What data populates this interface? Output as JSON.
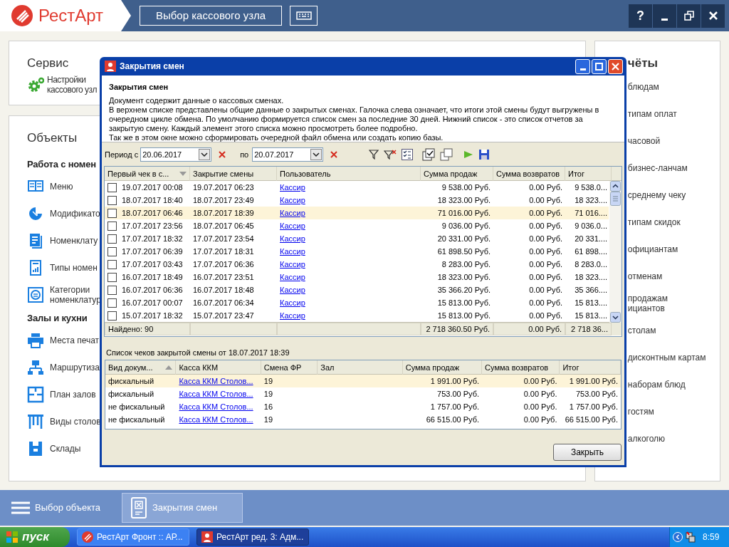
{
  "header": {
    "logo": "РестАрт",
    "node_button": "Выбор кассового узла",
    "buttons": [
      "?"
    ]
  },
  "service": {
    "title": "Сервис",
    "items": [
      {
        "lines": [
          "Настройки",
          "кассового узл"
        ]
      }
    ]
  },
  "objects": {
    "title": "Объекты",
    "groups": [
      {
        "title": "Работа с номен",
        "items": [
          {
            "kind": "menu",
            "lines": [
              "Меню"
            ]
          },
          {
            "kind": "modifiers",
            "lines": [
              "Модификато"
            ]
          },
          {
            "kind": "nomenclature",
            "lines": [
              "Номенклату"
            ]
          },
          {
            "kind": "types",
            "lines": [
              "Типы номен"
            ]
          },
          {
            "kind": "categories",
            "lines": [
              "Категории",
              "номенклатур"
            ]
          }
        ]
      },
      {
        "title": "Залы и кухни",
        "items": [
          {
            "kind": "printer",
            "lines": [
              "Места печат"
            ]
          },
          {
            "kind": "routing",
            "lines": [
              "Маршрутиза"
            ]
          },
          {
            "kind": "plan",
            "lines": [
              "План залов"
            ]
          },
          {
            "kind": "tables",
            "lines": [
              "Виды столов"
            ]
          },
          {
            "kind": "storage",
            "lines": [
              "Склады"
            ]
          }
        ]
      }
    ]
  },
  "reports": {
    "title": "чёты",
    "items": [
      {
        "lines": [
          "блюдам"
        ]
      },
      {
        "lines": [
          "типам оплат"
        ]
      },
      {
        "lines": [
          "часовой"
        ]
      },
      {
        "lines": [
          "бизнес-ланчам"
        ]
      },
      {
        "lines": [
          "среднему чеку"
        ]
      },
      {
        "lines": [
          "типам скидок"
        ]
      },
      {
        "lines": [
          "официантам"
        ]
      },
      {
        "lines": [
          "отменам"
        ]
      },
      {
        "lines": [
          "продажам",
          "ициантов"
        ]
      },
      {
        "lines": [
          "столам"
        ]
      },
      {
        "lines": [
          "дисконтным картам"
        ]
      },
      {
        "lines": [
          "наборам блюд"
        ]
      },
      {
        "lines": [
          "гостям"
        ]
      },
      {
        "lines": [
          "алкоголю"
        ]
      }
    ]
  },
  "dialog": {
    "title": "Закрытия смен",
    "heading": "Закрытия смен",
    "description": [
      "Документ содержит данные о кассовых сменах.",
      "В верхнем списке представлены общие данные о закрытых сменах. Галочка слева означает, что итоги этой смены будут выгружены в очередном цикле обмена. По умолчанию формируется список смен за последние 30 дней. Нижний список - это список отчетов за закрытую смену. Каждый элемент этого списка можно просмотреть более подробно.",
      "Так же в этом окне можно сформировать очередной файл обмена или создать копию базы."
    ],
    "period_label": "Период с",
    "date_from": "20.06.2017",
    "to_label": "по",
    "date_to": "20.07.2017",
    "shifts": {
      "columns": [
        "Первый чек в с...",
        "Закрытие смены",
        "Пользователь",
        "Сумма продаж",
        "Сумма возвратов",
        "Итог"
      ],
      "rows": [
        {
          "checked": false,
          "selected": false,
          "cells": [
            "19.07.2017 00:08",
            "19.07.2017 06:23",
            "Кассир",
            "9 538.00 Руб.",
            "0.00 Руб.",
            "9 538.0..."
          ]
        },
        {
          "checked": false,
          "selected": false,
          "cells": [
            "18.07.2017 18:40",
            "18.07.2017 23:49",
            "Кассир",
            "18 323.00 Руб.",
            "0.00 Руб.",
            "18 323...."
          ]
        },
        {
          "checked": false,
          "selected": true,
          "cells": [
            "18.07.2017 06:46",
            "18.07.2017 18:39",
            "Кассир",
            "71 016.00 Руб.",
            "0.00 Руб.",
            "71 016...."
          ]
        },
        {
          "checked": false,
          "selected": false,
          "cells": [
            "17.07.2017 23:56",
            "18.07.2017 06:45",
            "Кассир",
            "9 036.00 Руб.",
            "0.00 Руб.",
            "9 036.0..."
          ]
        },
        {
          "checked": false,
          "selected": false,
          "cells": [
            "17.07.2017 18:32",
            "17.07.2017 23:54",
            "Кассир",
            "20 331.00 Руб.",
            "0.00 Руб.",
            "20 331...."
          ]
        },
        {
          "checked": false,
          "selected": false,
          "cells": [
            "17.07.2017 06:39",
            "17.07.2017 18:31",
            "Кассир",
            "61 898.50 Руб.",
            "0.00 Руб.",
            "61 898...."
          ]
        },
        {
          "checked": false,
          "selected": false,
          "cells": [
            "17.07.2017 03:43",
            "17.07.2017 06:36",
            "Кассир",
            "8 283.00 Руб.",
            "0.00 Руб.",
            "8 283.0..."
          ]
        },
        {
          "checked": false,
          "selected": false,
          "cells": [
            "16.07.2017 18:49",
            "16.07.2017 23:51",
            "Кассир",
            "18 323.00 Руб.",
            "0.00 Руб.",
            "18 323...."
          ]
        },
        {
          "checked": false,
          "selected": false,
          "cells": [
            "16.07.2017 06:36",
            "16.07.2017 18:48",
            "Кассир",
            "35 366.20 Руб.",
            "0.00 Руб.",
            "35 366...."
          ]
        },
        {
          "checked": false,
          "selected": false,
          "cells": [
            "16.07.2017 00:07",
            "16.07.2017 06:34",
            "Кассир",
            "15 813.00 Руб.",
            "0.00 Руб.",
            "15 813...."
          ]
        },
        {
          "checked": false,
          "selected": false,
          "cells": [
            "15.07.2017 18:32",
            "15.07.2017 23:47",
            "Кассир",
            "15 813.00 Руб.",
            "0.00 Руб.",
            "15 813...."
          ]
        }
      ],
      "footer": {
        "found": "Найдено: 90",
        "sales": "2 718 360.50 Руб.",
        "returns": "0.00 Руб.",
        "total": "2 718 36..."
      }
    },
    "receipts_label": "Список чеков закрытой смены от 18.07.2017 18:39",
    "receipts": {
      "columns": [
        "Вид докум...",
        "Касса ККМ",
        "Смена ФР",
        "Зал",
        "Сумма продаж",
        "Сумма возвратов",
        "Итог"
      ],
      "rows": [
        {
          "selected": true,
          "type": "фискальный",
          "register": "Касса ККМ Столов...",
          "shift": "19",
          "sales": "1 991.00 Руб.",
          "returns": "0.00 Руб.",
          "total": "1 991.00 Руб."
        },
        {
          "selected": false,
          "type": "фискальный",
          "register": "Касса ККМ Столов...",
          "shift": "19",
          "sales": "753.00 Руб.",
          "returns": "0.00 Руб.",
          "total": "753.00 Руб."
        },
        {
          "selected": false,
          "type": "не фискальный",
          "register": "Касса ККМ Столов...",
          "shift": "16",
          "sales": "1 757.00 Руб.",
          "returns": "0.00 Руб.",
          "total": "1 757.00 Руб."
        },
        {
          "selected": false,
          "type": "не фискальный",
          "register": "Касса ККМ Столов...",
          "shift": "19",
          "sales": "66 515.00 Руб.",
          "returns": "0.00 Руб.",
          "total": "66 515.00 Руб."
        }
      ]
    },
    "close_button": "Закрыть"
  },
  "bottom_bar": {
    "menu_label": "Выбор объекта",
    "tabs": [
      {
        "label": "Закрытия смен",
        "selected": true
      }
    ]
  },
  "taskbar": {
    "start": "пуск",
    "tasks": [
      {
        "kind": "front",
        "label": "РестАрт Фронт :: АР...",
        "selected": false
      },
      {
        "kind": "admin",
        "label": "РестАрт ред. 3: Адм...",
        "selected": true
      }
    ],
    "clock": "8:59"
  }
}
